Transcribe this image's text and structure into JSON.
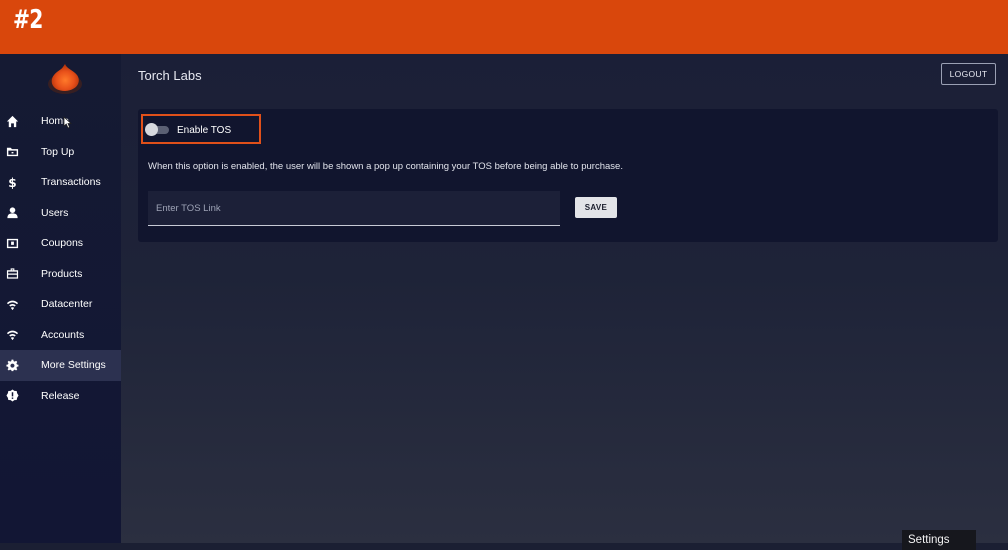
{
  "banner": {
    "label": "#2",
    "color": "#d9470c"
  },
  "app": {
    "title": "Torch Labs",
    "logout_label": "LOGOUT"
  },
  "sidebar": {
    "logo_icon": "flame-logo-icon",
    "items": [
      {
        "label": "Home",
        "icon": "home-icon",
        "active": false
      },
      {
        "label": "Top Up",
        "icon": "wallet-icon",
        "active": false
      },
      {
        "label": "Transactions",
        "icon": "dollar-icon",
        "active": false
      },
      {
        "label": "Users",
        "icon": "user-icon",
        "active": false
      },
      {
        "label": "Coupons",
        "icon": "coupon-icon",
        "active": false
      },
      {
        "label": "Products",
        "icon": "briefcase-icon",
        "active": false
      },
      {
        "label": "Datacenter",
        "icon": "wifi-icon",
        "active": false
      },
      {
        "label": "Accounts",
        "icon": "wifi-icon",
        "active": false
      },
      {
        "label": "More Settings",
        "icon": "gear-icon",
        "active": true
      },
      {
        "label": "Release",
        "icon": "release-badge-icon",
        "active": false
      }
    ]
  },
  "tos": {
    "toggle_label": "Enable TOS",
    "enabled": false,
    "description": "When this option is enabled, the user will be shown a pop up containing your TOS before being able to purchase.",
    "input_placeholder": "Enter TOS Link",
    "input_value": "",
    "save_label": "SAVE"
  },
  "tooltip": {
    "text": "Settings"
  },
  "colors": {
    "accent": "#e0501a",
    "sidebar_bg": "#151a33",
    "card_bg": "#11152e",
    "active_item_bg": "#2c3150"
  }
}
